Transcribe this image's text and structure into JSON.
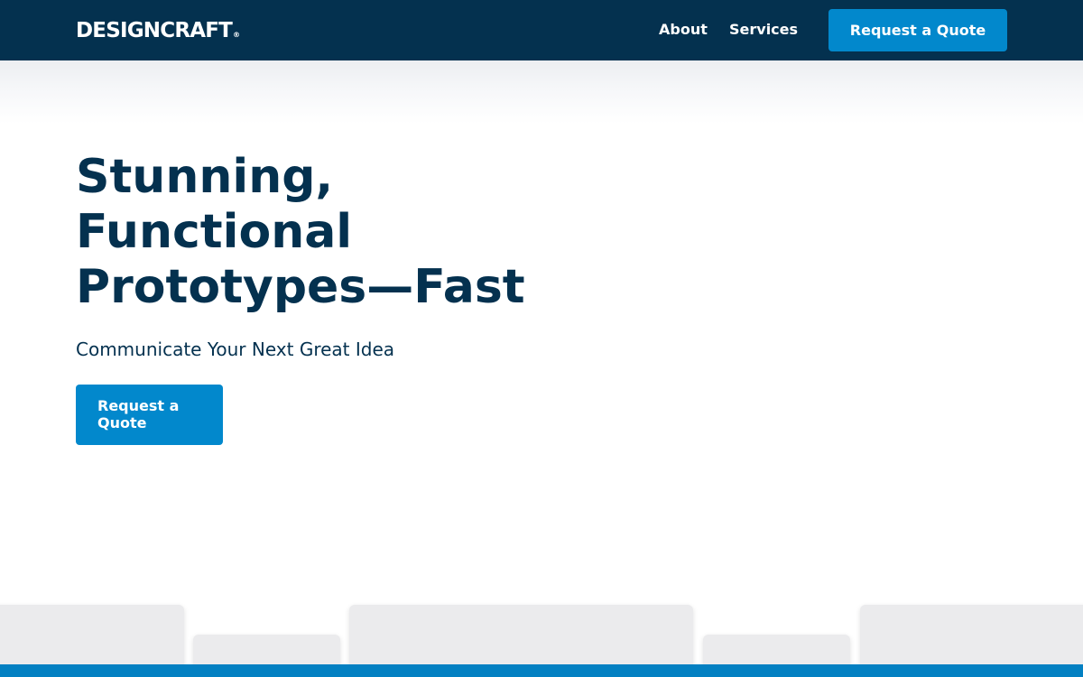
{
  "brand": {
    "logo_text": "DESIGNCRAFT",
    "logo_mark": "®"
  },
  "nav": {
    "links": [
      {
        "label": "About"
      },
      {
        "label": "Services"
      }
    ],
    "cta_label": "Request a Quote"
  },
  "hero": {
    "title": "Stunning, Functional Prototypes—Fast",
    "subtitle": "Communicate Your Next Great Idea",
    "cta_label": "Request a Quote"
  },
  "colors": {
    "navy": "#04314f",
    "accent_blue": "#0288cc",
    "card_gray": "#ebebed"
  }
}
